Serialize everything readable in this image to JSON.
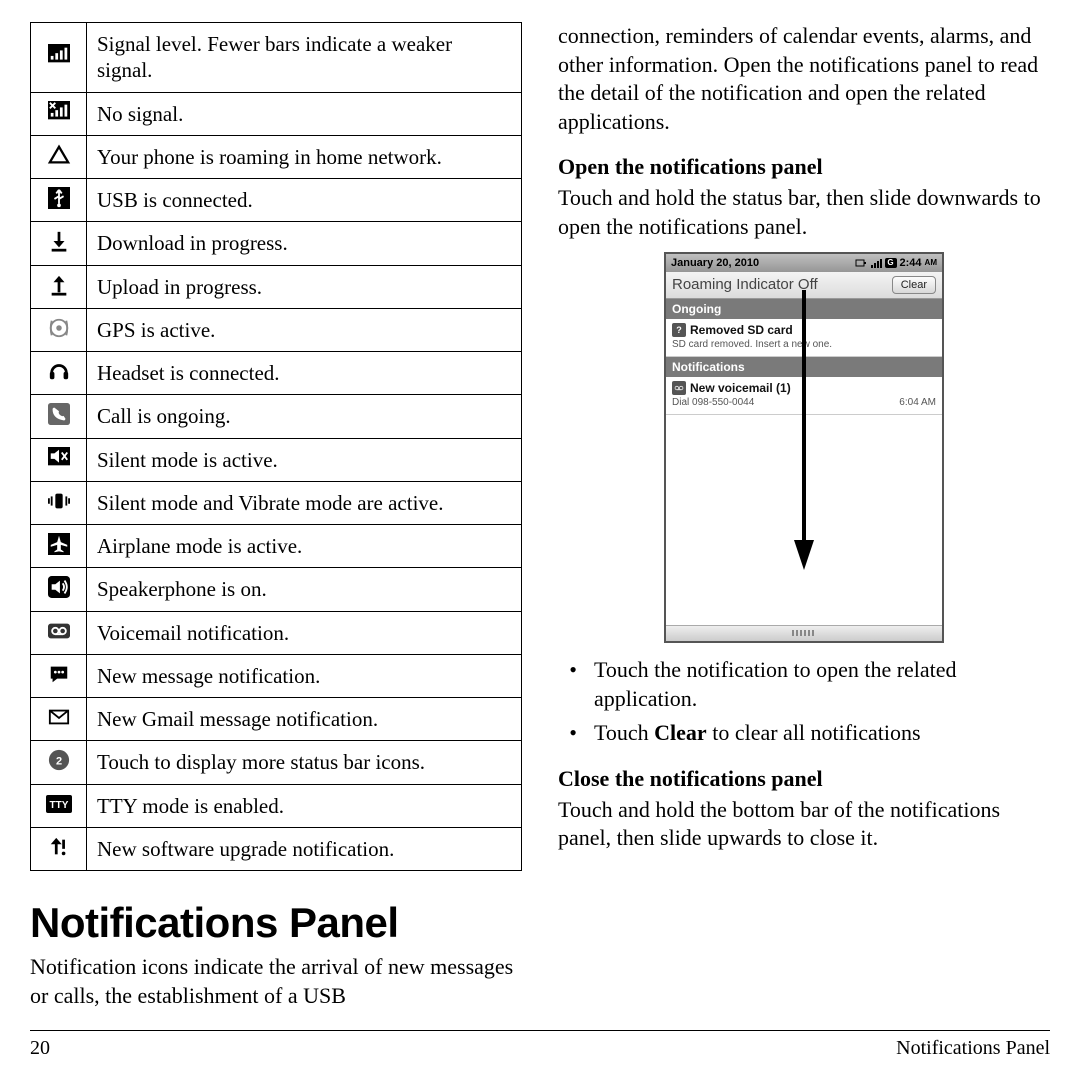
{
  "icon_table": [
    {
      "icon": "signal",
      "desc": "Signal level. Fewer bars indicate a weaker signal."
    },
    {
      "icon": "no-signal",
      "desc": "No signal."
    },
    {
      "icon": "roaming",
      "desc": "Your phone is roaming in home network."
    },
    {
      "icon": "usb",
      "desc": "USB is connected."
    },
    {
      "icon": "download",
      "desc": "Download in progress."
    },
    {
      "icon": "upload",
      "desc": "Upload in progress."
    },
    {
      "icon": "gps",
      "desc": "GPS is active."
    },
    {
      "icon": "headset",
      "desc": "Headset is connected."
    },
    {
      "icon": "call",
      "desc": "Call is ongoing."
    },
    {
      "icon": "silent",
      "desc": "Silent mode is active."
    },
    {
      "icon": "vibrate",
      "desc": "Silent mode and Vibrate mode are active."
    },
    {
      "icon": "airplane",
      "desc": "Airplane mode is active."
    },
    {
      "icon": "speaker",
      "desc": "Speakerphone is on."
    },
    {
      "icon": "voicemail",
      "desc": "Voicemail notification."
    },
    {
      "icon": "message",
      "desc": "New message notification."
    },
    {
      "icon": "gmail",
      "desc": "New Gmail message notification."
    },
    {
      "icon": "more",
      "desc": "Touch to display more status bar icons."
    },
    {
      "icon": "tty",
      "desc": "TTY mode is enabled."
    },
    {
      "icon": "upgrade",
      "desc": "New software upgrade notification."
    }
  ],
  "heading": "Notifications Panel",
  "left_intro": "Notification icons indicate the arrival of new messages or calls, the establishment of a USB",
  "right_intro": "connection, reminders of calendar events, alarms, and other information. Open the notifications panel to read the detail of the notification and open the related applications.",
  "open_head": "Open the notifications panel",
  "open_body": "Touch and hold the status bar, then slide downwards to open the notifications panel.",
  "bullets": {
    "b1_pre": "Touch the notification to open the related application.",
    "b2_pre": "Touch ",
    "b2_bold": "Clear",
    "b2_post": " to clear all notifications"
  },
  "close_head": "Close the notifications panel",
  "close_body": "Touch and hold the bottom bar of the notifications panel, then slide upwards to close it.",
  "phone": {
    "date": "January 20, 2010",
    "time": "2:44",
    "ampm": "AM",
    "title": "Roaming Indicator Off",
    "clear": "Clear",
    "ongoing": "Ongoing",
    "sd_title": "Removed SD card",
    "sd_sub": "SD card removed. Insert a new one.",
    "notifs": "Notifications",
    "vm_title": "New voicemail (1)",
    "vm_sub": "Dial 098-550-0044",
    "vm_time": "6:04 AM"
  },
  "footer": {
    "page": "20",
    "title": "Notifications Panel"
  }
}
